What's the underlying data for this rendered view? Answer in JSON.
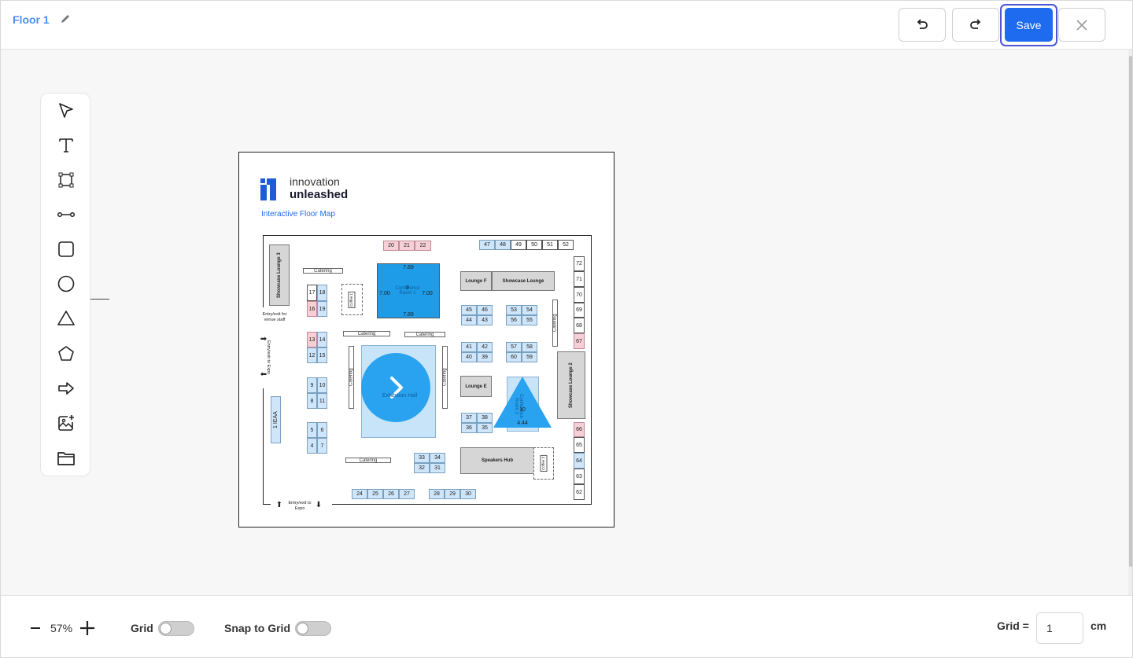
{
  "header": {
    "floor_title": "Floor 1",
    "save_label": "Save"
  },
  "icons": {
    "edit": "pencil-icon",
    "undo": "undo-icon",
    "redo": "redo-icon",
    "close": "close-icon"
  },
  "tools": [
    "pointer-icon",
    "text-icon",
    "polygon-edit-icon",
    "line-icon",
    "rectangle-icon",
    "circle-icon",
    "triangle-icon",
    "pentagon-icon",
    "arrow-icon",
    "add-image-icon",
    "folder-icon"
  ],
  "map": {
    "brand_line1": "innovation",
    "brand_line2": "unleashed",
    "subtitle": "Interactive Floor Map",
    "booths": {
      "b20": "20",
      "b21": "21",
      "b22": "22",
      "b47": "47",
      "b48": "48",
      "b49": "49",
      "b50": "50",
      "b51": "51",
      "b52": "52",
      "b72": "72",
      "b71": "71",
      "b70": "70",
      "b69": "69",
      "b68": "68",
      "b67": "67",
      "b66": "66",
      "b65": "65",
      "b64": "64",
      "b63": "63",
      "b62": "62",
      "b17": "17",
      "b18": "18",
      "b16": "16",
      "b19": "19",
      "b13": "13",
      "b14": "14",
      "b12": "12",
      "b15": "15",
      "b9": "9",
      "b10": "10",
      "b8": "8",
      "b11": "11",
      "b5": "5",
      "b6": "6",
      "b4": "4",
      "b7": "7",
      "b45": "45",
      "b46": "46",
      "b44": "44",
      "b43": "43",
      "b53": "53",
      "b54": "54",
      "b56": "56",
      "b55": "55",
      "b41": "41",
      "b42": "42",
      "b40": "40",
      "b39": "39",
      "b57": "57",
      "b58": "58",
      "b60": "60",
      "b59": "59",
      "b37": "37",
      "b38": "38",
      "b36": "36",
      "b35": "35",
      "b33": "33",
      "b34": "34",
      "b32": "32",
      "b31": "31",
      "b24": "24",
      "b25": "25",
      "b26": "26",
      "b27": "27",
      "b28": "28",
      "b29": "29",
      "b30": "30"
    },
    "areas": {
      "lounge_f": "Lounge F",
      "showcase_lounge": "Showcase Lounge",
      "lounge_e": "Lounge E",
      "speakers_hub": "Speakers Hub",
      "showcase3": "Showcase Lounge 3",
      "showcase2": "Showcase Lounge 2",
      "ieaa": "1 IEAA",
      "catering": "Catering",
      "coffee1": "Coffee 1",
      "coffee2": "Coffee 2",
      "entry_staff": "Entry/exit for venue staff",
      "entry_side": "Entry/exit to Expo",
      "entry_bottom": "Entry/exit to Expo"
    },
    "overlay": {
      "conf1_label": "Conference Room 1",
      "conf1_num": "9",
      "dim_top": "7.89",
      "dim_bottom": "7.89",
      "dim_left": "7.00",
      "dim_right": "7.00",
      "hall_label": "Exhibition Hall",
      "conf2_label": "Conference Room 2",
      "conf2_num": "10",
      "dim_tri": "4.44"
    }
  },
  "footer": {
    "zoom": "57%",
    "grid_label": "Grid",
    "snap_label": "Snap to Grid",
    "grid_eq": "Grid =",
    "grid_value": "1",
    "unit": "cm"
  }
}
